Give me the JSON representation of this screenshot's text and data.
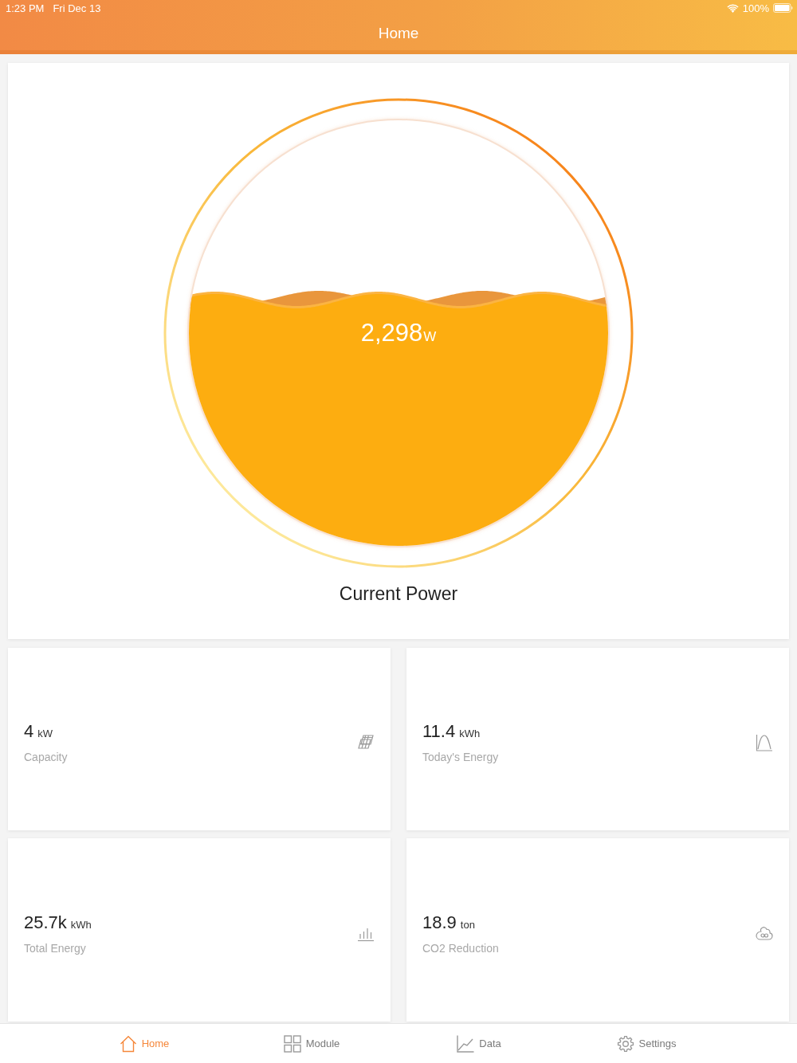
{
  "status_bar": {
    "time": "1:23 PM",
    "date": "Fri Dec 13",
    "battery": "100%"
  },
  "header": {
    "title": "Home"
  },
  "gauge": {
    "value": "2,298",
    "unit": "W",
    "level": 0.57,
    "caption": "Current Power"
  },
  "stats": [
    {
      "kind": "capacity",
      "value": "4",
      "unit": "kW",
      "label": "Capacity"
    },
    {
      "kind": "daily",
      "value": "11.4",
      "unit": "kWh",
      "label": "Today's Energy"
    },
    {
      "kind": "total",
      "value": "25.7k",
      "unit": "kWh",
      "label": "Total Energy"
    },
    {
      "kind": "emission",
      "value": "18.9",
      "unit": "ton",
      "label": "CO2 Reduction"
    }
  ],
  "tabs": [
    {
      "kind": "home",
      "label": "Home",
      "selected": true
    },
    {
      "kind": "module",
      "label": "Module",
      "selected": false
    },
    {
      "kind": "data",
      "label": "Data",
      "selected": false
    },
    {
      "kind": "settings",
      "label": "Settings",
      "selected": false
    }
  ]
}
